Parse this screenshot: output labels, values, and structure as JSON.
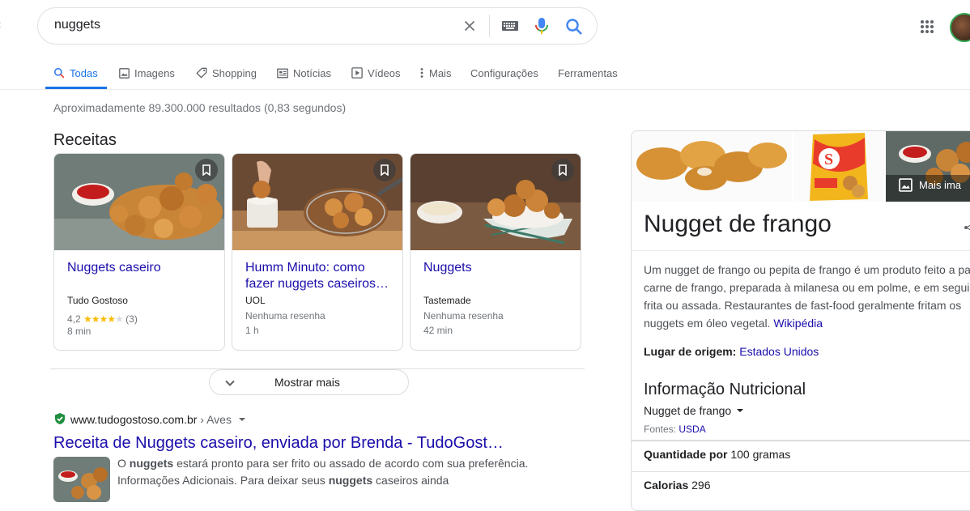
{
  "search": {
    "query": "nuggets"
  },
  "tabs": [
    {
      "label": "Todas",
      "icon": "search-icon"
    },
    {
      "label": "Imagens",
      "icon": "image-icon"
    },
    {
      "label": "Shopping",
      "icon": "tag-icon"
    },
    {
      "label": "Notícias",
      "icon": "news-icon"
    },
    {
      "label": "Vídeos",
      "icon": "play-icon"
    },
    {
      "label": "Mais",
      "icon": "more-vert-icon"
    },
    {
      "label": "Configurações"
    },
    {
      "label": "Ferramentas"
    }
  ],
  "stats": "Aproximadamente 89.300.000 resultados (0,83 segundos)",
  "recipes": {
    "title": "Receitas",
    "cards": [
      {
        "title": "Nuggets caseiro",
        "source": "Tudo Gostoso",
        "rating": "4,2",
        "stars": 4,
        "reviews": "(3)",
        "time": "8 min"
      },
      {
        "title": "Humm Minuto: como fazer nuggets caseiros…",
        "source": "UOL",
        "reviews": "Nenhuma resenha",
        "time": "1 h"
      },
      {
        "title": "Nuggets",
        "source": "Tastemade",
        "reviews": "Nenhuma resenha",
        "time": "42 min"
      }
    ],
    "show_more": "Mostrar mais"
  },
  "result": {
    "url": "www.tudogostoso.com.br",
    "breadcrumb": "› Aves",
    "title": "Receita de Nuggets caseiro, enviada por Brenda - TudoGost…",
    "snippet": {
      "p1": "O ",
      "b1": "nuggets",
      "p2": " estará pronto para ser frito ou assado de acordo com sua preferência. Informações Adicionais. Para deixar seus ",
      "b2": "nuggets",
      "p3": " caseiros ainda"
    }
  },
  "knowledge_panel": {
    "more_images": "Mais ima",
    "title": "Nugget de frango",
    "description": "Um nugget de frango ou pepita de frango é um produto feito a pa de carne de frango, preparada à milanesa ou em polme, e em seguida frita ou assada. Restaurantes de fast-food geralmente fritam os nuggets em óleo vegetal.",
    "description_link": "Wikipédia",
    "origin_label": "Lugar de origem:",
    "origin_value": "Estados Unidos",
    "nutrition_title": "Informação Nutricional",
    "nutrition_item": "Nugget de frango",
    "sources_label": "Fontes:",
    "sources_link": "USDA",
    "quantity_label": "Quantidade por",
    "quantity_value": "100 gramas",
    "calories_label": "Calorias",
    "calories_value": "296"
  },
  "colors": {
    "link": "#1a0dab",
    "accent": "#1a73e8",
    "star": "#fbbc04",
    "secure": "#1e8e3e"
  }
}
